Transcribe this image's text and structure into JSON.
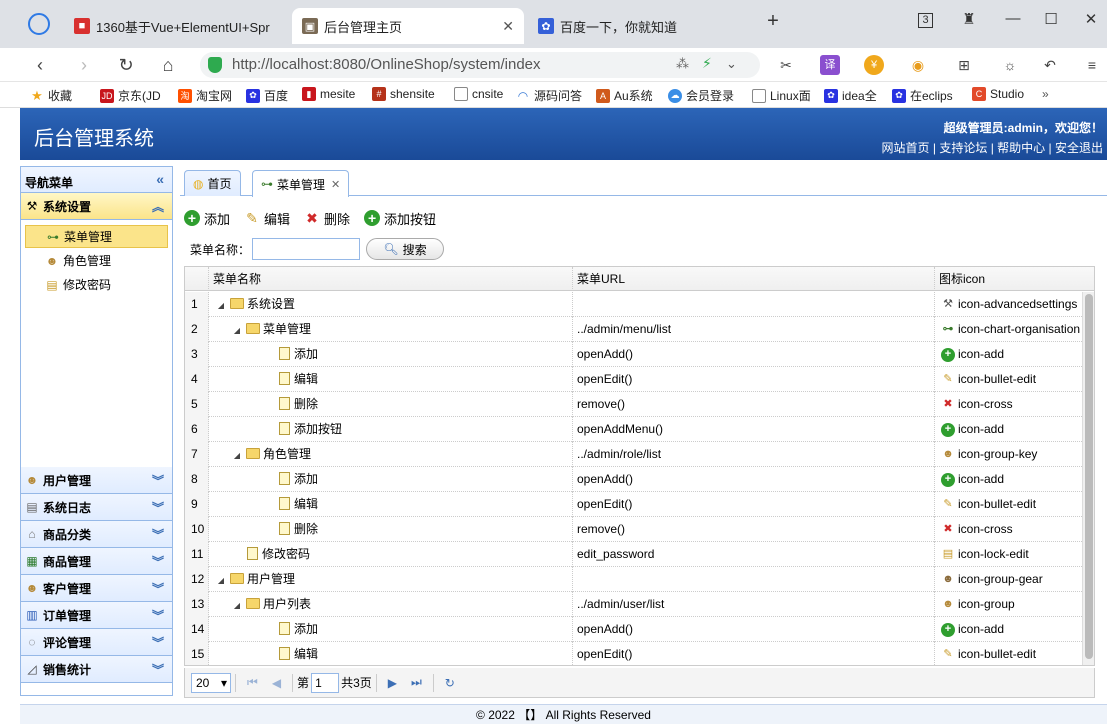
{
  "browser": {
    "tabs": [
      {
        "title": "1360基于Vue+ElementUI+Spr",
        "active": false
      },
      {
        "title": "后台管理主页",
        "active": true
      },
      {
        "title": "百度一下，你就知道",
        "active": false
      }
    ],
    "tab_counter": "3",
    "url": "http://localhost:8080/OnlineShop/system/index",
    "bookmarks": [
      "收藏",
      "京东(JD",
      "淘宝网",
      "百度",
      "mesite",
      "shensite",
      "cnsite",
      "源码问答",
      "Au系统",
      "会员登录",
      "Linux面",
      "idea全",
      "在eclips",
      "Studio"
    ]
  },
  "header": {
    "title": "后台管理系统",
    "welcome": "超级管理员:admin，欢迎您！",
    "links": [
      "网站首页",
      "支持论坛",
      "帮助中心",
      "安全退出"
    ],
    "link_sep": "|"
  },
  "sidebar": {
    "title": "导航菜单",
    "open_panel": "系统设置",
    "open_items": [
      "菜单管理",
      "角色管理",
      "修改密码"
    ],
    "selected_item": "菜单管理",
    "panels": [
      "用户管理",
      "系统日志",
      "商品分类",
      "商品管理",
      "客户管理",
      "订单管理",
      "评论管理",
      "销售统计"
    ]
  },
  "main": {
    "tabs": [
      {
        "label": "首页",
        "closable": false
      },
      {
        "label": "菜单管理",
        "closable": true
      }
    ],
    "actions": [
      "添加",
      "编辑",
      "删除",
      "添加按钮"
    ],
    "search_label": "菜单名称：",
    "search_value": "",
    "search_button": "搜索",
    "columns": [
      "菜单名称",
      "菜单URL",
      "图标icon"
    ],
    "rows": [
      {
        "n": "1",
        "level": 0,
        "type": "folder",
        "name": "系统设置",
        "url": "",
        "icon": "icon-advancedsettings",
        "icon_sym": "advanced-settings-icon"
      },
      {
        "n": "2",
        "level": 1,
        "type": "folder",
        "name": "菜单管理",
        "url": "../admin/menu/list",
        "icon": "icon-chart-organisation",
        "icon_sym": "chart-organisation-icon"
      },
      {
        "n": "3",
        "level": 2,
        "type": "file",
        "name": "添加",
        "url": "openAdd()",
        "icon": "icon-add",
        "icon_sym": "add-icon"
      },
      {
        "n": "4",
        "level": 2,
        "type": "file",
        "name": "编辑",
        "url": "openEdit()",
        "icon": "icon-bullet-edit",
        "icon_sym": "bullet-edit-icon"
      },
      {
        "n": "5",
        "level": 2,
        "type": "file",
        "name": "删除",
        "url": "remove()",
        "icon": "icon-cross",
        "icon_sym": "cross-icon"
      },
      {
        "n": "6",
        "level": 2,
        "type": "file",
        "name": "添加按钮",
        "url": "openAddMenu()",
        "icon": "icon-add",
        "icon_sym": "add-icon"
      },
      {
        "n": "7",
        "level": 1,
        "type": "folder",
        "name": "角色管理",
        "url": "../admin/role/list",
        "icon": "icon-group-key",
        "icon_sym": "group-key-icon"
      },
      {
        "n": "8",
        "level": 2,
        "type": "file",
        "name": "添加",
        "url": "openAdd()",
        "icon": "icon-add",
        "icon_sym": "add-icon"
      },
      {
        "n": "9",
        "level": 2,
        "type": "file",
        "name": "编辑",
        "url": "openEdit()",
        "icon": "icon-bullet-edit",
        "icon_sym": "bullet-edit-icon"
      },
      {
        "n": "10",
        "level": 2,
        "type": "file",
        "name": "删除",
        "url": "remove()",
        "icon": "icon-cross",
        "icon_sym": "cross-icon"
      },
      {
        "n": "11",
        "level": 1,
        "type": "file",
        "name": "修改密码",
        "url": "edit_password",
        "icon": "icon-lock-edit",
        "icon_sym": "lock-edit-icon"
      },
      {
        "n": "12",
        "level": 0,
        "type": "folder",
        "name": "用户管理",
        "url": "",
        "icon": "icon-group-gear",
        "icon_sym": "group-gear-icon"
      },
      {
        "n": "13",
        "level": 1,
        "type": "folder",
        "name": "用户列表",
        "url": "../admin/user/list",
        "icon": "icon-group",
        "icon_sym": "group-icon"
      },
      {
        "n": "14",
        "level": 2,
        "type": "file",
        "name": "添加",
        "url": "openAdd()",
        "icon": "icon-add",
        "icon_sym": "add-icon"
      },
      {
        "n": "15",
        "level": 2,
        "type": "file",
        "name": "编辑",
        "url": "openEdit()",
        "icon": "icon-bullet-edit",
        "icon_sym": "bullet-edit-icon"
      }
    ],
    "pager": {
      "page_size": "20",
      "page_label": "第",
      "page": "1",
      "total_label": "共3页"
    }
  },
  "footer": "© 2022 【】 All Rights Reserved",
  "colors": {
    "header_blue": "#1a4a98",
    "panel_border": "#95b8e7",
    "selected_yellow": "#fbe48a"
  }
}
